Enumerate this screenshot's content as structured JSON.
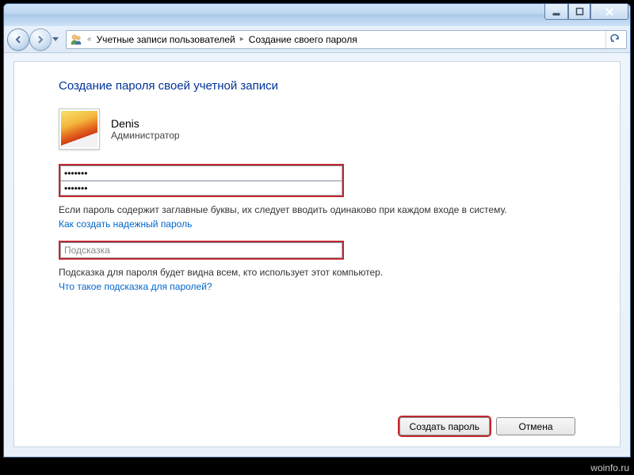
{
  "breadcrumb": {
    "prefix_glyph": "«",
    "level1": "Учетные записи пользователей",
    "level2": "Создание своего пароля"
  },
  "page": {
    "heading": "Создание пароля своей учетной записи"
  },
  "user": {
    "name": "Denis",
    "role": "Администратор"
  },
  "password": {
    "value1": "•••••••",
    "value2": "•••••••",
    "caps_warning": "Если пароль содержит заглавные буквы, их следует вводить одинаково при каждом входе в систему.",
    "strong_link": "Как создать надежный пароль"
  },
  "hint": {
    "value": "Подсказка",
    "visible_warning": "Подсказка для пароля будет видна всем, кто использует этот компьютер.",
    "what_is_link": "Что такое подсказка для паролей?"
  },
  "buttons": {
    "create": "Создать пароль",
    "cancel": "Отмена"
  },
  "watermark": "woinfo.ru"
}
